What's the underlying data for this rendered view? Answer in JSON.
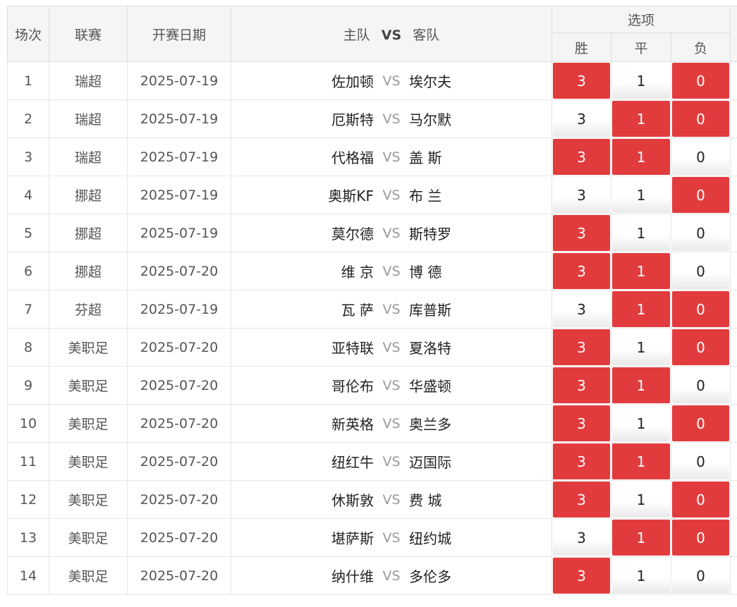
{
  "header": {
    "index": "场次",
    "league": "联赛",
    "date": "开赛日期",
    "home": "主队",
    "vs": "VS",
    "away": "客队",
    "options": "选项",
    "win": "胜",
    "draw": "平",
    "lose": "负"
  },
  "colors": {
    "selected": "#e23b3d",
    "unselected": "#ffffff"
  },
  "rows": [
    {
      "idx": "1",
      "league": "瑞超",
      "date": "2025-07-19",
      "home": "佐加顿",
      "vs": "VS",
      "away": "埃尔夫",
      "win": "3",
      "draw": "1",
      "lose": "0",
      "sel": [
        true,
        false,
        true
      ]
    },
    {
      "idx": "2",
      "league": "瑞超",
      "date": "2025-07-19",
      "home": "厄斯特",
      "vs": "VS",
      "away": "马尔默",
      "win": "3",
      "draw": "1",
      "lose": "0",
      "sel": [
        false,
        true,
        true
      ]
    },
    {
      "idx": "3",
      "league": "瑞超",
      "date": "2025-07-19",
      "home": "代格福",
      "vs": "VS",
      "away": "盖 斯",
      "win": "3",
      "draw": "1",
      "lose": "0",
      "sel": [
        true,
        true,
        false
      ]
    },
    {
      "idx": "4",
      "league": "挪超",
      "date": "2025-07-19",
      "home": "奥斯KF",
      "vs": "VS",
      "away": "布 兰",
      "win": "3",
      "draw": "1",
      "lose": "0",
      "sel": [
        false,
        false,
        true
      ]
    },
    {
      "idx": "5",
      "league": "挪超",
      "date": "2025-07-19",
      "home": "莫尔德",
      "vs": "VS",
      "away": "斯特罗",
      "win": "3",
      "draw": "1",
      "lose": "0",
      "sel": [
        true,
        false,
        false
      ]
    },
    {
      "idx": "6",
      "league": "挪超",
      "date": "2025-07-20",
      "home": "维 京",
      "vs": "VS",
      "away": "博 德",
      "win": "3",
      "draw": "1",
      "lose": "0",
      "sel": [
        true,
        true,
        false
      ]
    },
    {
      "idx": "7",
      "league": "芬超",
      "date": "2025-07-19",
      "home": "瓦 萨",
      "vs": "VS",
      "away": "库普斯",
      "win": "3",
      "draw": "1",
      "lose": "0",
      "sel": [
        false,
        true,
        true
      ]
    },
    {
      "idx": "8",
      "league": "美职足",
      "date": "2025-07-20",
      "home": "亚特联",
      "vs": "VS",
      "away": "夏洛特",
      "win": "3",
      "draw": "1",
      "lose": "0",
      "sel": [
        true,
        false,
        true
      ]
    },
    {
      "idx": "9",
      "league": "美职足",
      "date": "2025-07-20",
      "home": "哥伦布",
      "vs": "VS",
      "away": "华盛顿",
      "win": "3",
      "draw": "1",
      "lose": "0",
      "sel": [
        true,
        true,
        false
      ]
    },
    {
      "idx": "10",
      "league": "美职足",
      "date": "2025-07-20",
      "home": "新英格",
      "vs": "VS",
      "away": "奥兰多",
      "win": "3",
      "draw": "1",
      "lose": "0",
      "sel": [
        true,
        false,
        true
      ]
    },
    {
      "idx": "11",
      "league": "美职足",
      "date": "2025-07-20",
      "home": "纽红牛",
      "vs": "VS",
      "away": "迈国际",
      "win": "3",
      "draw": "1",
      "lose": "0",
      "sel": [
        true,
        true,
        false
      ]
    },
    {
      "idx": "12",
      "league": "美职足",
      "date": "2025-07-20",
      "home": "休斯敦",
      "vs": "VS",
      "away": "费 城",
      "win": "3",
      "draw": "1",
      "lose": "0",
      "sel": [
        true,
        false,
        true
      ]
    },
    {
      "idx": "13",
      "league": "美职足",
      "date": "2025-07-20",
      "home": "堪萨斯",
      "vs": "VS",
      "away": "纽约城",
      "win": "3",
      "draw": "1",
      "lose": "0",
      "sel": [
        false,
        true,
        true
      ]
    },
    {
      "idx": "14",
      "league": "美职足",
      "date": "2025-07-20",
      "home": "纳什维",
      "vs": "VS",
      "away": "多伦多",
      "win": "3",
      "draw": "1",
      "lose": "0",
      "sel": [
        true,
        false,
        false
      ]
    }
  ]
}
